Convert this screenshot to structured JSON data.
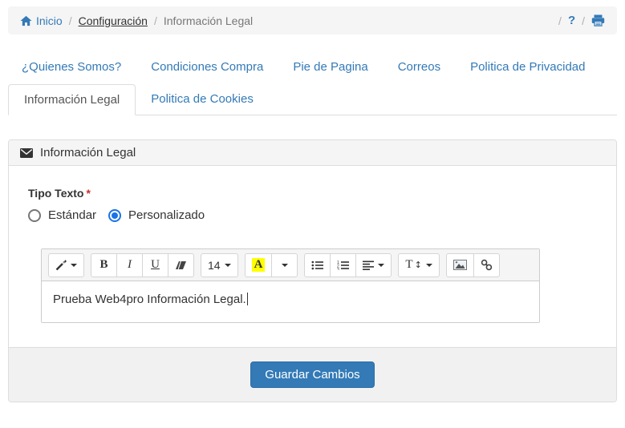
{
  "breadcrumb": {
    "home_label": "Inicio",
    "sep": "/",
    "config_label": "Configuración",
    "current_label": "Información Legal",
    "help_label": "?"
  },
  "tabs_row1": [
    {
      "label": "¿Quienes Somos?"
    },
    {
      "label": "Condiciones Compra"
    },
    {
      "label": "Pie de Pagina"
    },
    {
      "label": "Correos"
    },
    {
      "label": "Politica de Privacidad"
    }
  ],
  "tabs_row2": [
    {
      "label": "Información Legal",
      "active": true
    },
    {
      "label": "Politica de Cookies",
      "active": false
    }
  ],
  "panel": {
    "header_title": "Información Legal",
    "form": {
      "field_label": "Tipo Texto",
      "required_mark": "*",
      "radio_options": [
        {
          "label": "Estándar",
          "checked": false
        },
        {
          "label": "Personalizado",
          "checked": true
        }
      ],
      "selected_option": "Personalizado"
    },
    "editor": {
      "toolbar": {
        "bold_label": "B",
        "italic_label": "I",
        "underline_label": "U",
        "font_size_value": "14",
        "color_letter": "A",
        "line_height_letter": "T",
        "line_height_arrow": "↕"
      },
      "content_text": "Prueba Web4pro Información Legal."
    },
    "footer": {
      "save_button_label": "Guardar Cambios"
    }
  },
  "icons": {
    "home": "home-icon",
    "help": "question-mark",
    "print": "printer-icon",
    "header": "envelope-icon",
    "style_dropdown": "magic-wand-icon",
    "clear_format": "eraser-icon",
    "unordered_list": "list-ul-icon",
    "ordered_list": "list-ol-icon",
    "paragraph_align": "align-left-icon",
    "insert_image": "image-icon",
    "insert_link": "link-icon"
  },
  "colors": {
    "link_blue": "#337ab7",
    "primary_button_bg": "#337ab7",
    "primary_button_border": "#2e6da4",
    "radio_checked": "#1a73e8",
    "color_button_highlight": "#ffff00",
    "bar_gray": "#f5f5f5",
    "border_gray": "#dddddd",
    "required_red": "#c9302c"
  }
}
